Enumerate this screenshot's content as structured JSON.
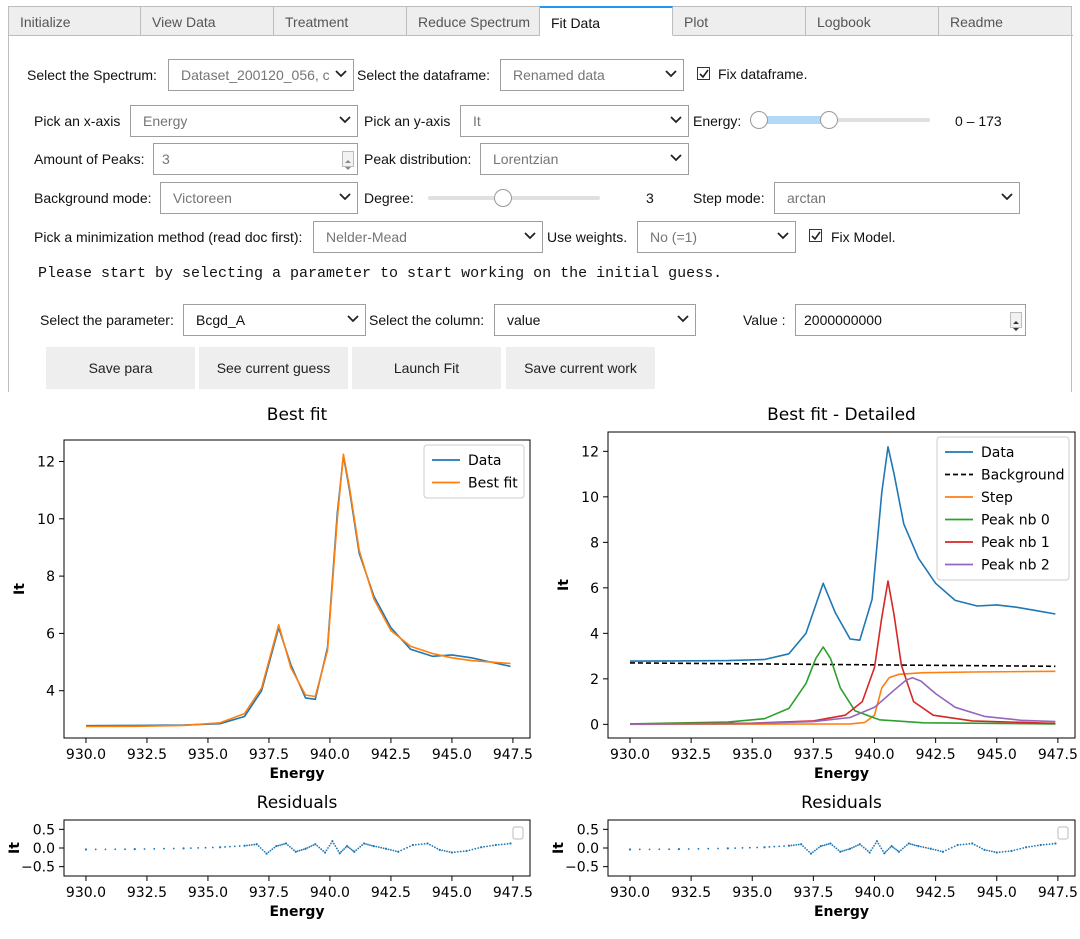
{
  "tabs": [
    "Initialize",
    "View Data",
    "Treatment",
    "Reduce Spectrum",
    "Fit Data",
    "Plot",
    "Logbook",
    "Readme"
  ],
  "active_tab": "Fit Data",
  "form": {
    "spectrum_label": "Select the Spectrum:",
    "spectrum_value": "Dataset_200120_056, c",
    "dataframe_label": "Select the dataframe:",
    "dataframe_value": "Renamed data",
    "fix_dataframe_label": "Fix dataframe.",
    "fix_dataframe_checked": true,
    "xaxis_label": "Pick an x-axis",
    "xaxis_value": "Energy",
    "yaxis_label": "Pick an y-axis",
    "yaxis_value": "It",
    "energy_label": "Energy:",
    "energy_range_text": "0 – 173",
    "peaks_label": "Amount of Peaks:",
    "peaks_value": "3",
    "peak_dist_label": "Peak distribution:",
    "peak_dist_value": "Lorentzian",
    "bg_mode_label": "Background mode:",
    "bg_mode_value": "Victoreen",
    "degree_label": "Degree:",
    "degree_value": "3",
    "step_mode_label": "Step mode:",
    "step_mode_value": "arctan",
    "minim_label": "Pick a minimization method (read doc first):",
    "minim_value": "Nelder-Mead",
    "weights_label": "Use weights.",
    "weights_value": "No (=1)",
    "fix_model_label": "Fix Model.",
    "fix_model_checked": true,
    "message": "Please start by selecting a parameter to start working on the initial guess.",
    "param_label": "Select the parameter:",
    "param_value": "Bcgd_A",
    "column_label": "Select the column:",
    "column_value": "value",
    "value_label": "Value :",
    "value_value": "2000000000"
  },
  "buttons": [
    "Save para",
    "See current guess",
    "Launch Fit",
    "Save current work"
  ],
  "colors": {
    "tab_accent": "#2196f3",
    "data": "#1f77b4",
    "fit": "#ff7f0e",
    "background": "#000000",
    "step": "#ff7f0e",
    "peak0": "#2ca02c",
    "peak1": "#d62728",
    "peak2": "#9467bd"
  },
  "chart_data": [
    {
      "type": "line",
      "title": "Best fit",
      "xlabel": "Energy",
      "ylabel": "It",
      "xlim": [
        929.1,
        948.2
      ],
      "ylim": [
        2.35,
        12.75
      ],
      "xticks": [
        "930.0",
        "932.5",
        "935.0",
        "937.5",
        "940.0",
        "942.5",
        "945.0",
        "947.5"
      ],
      "yticks": [
        "4",
        "6",
        "8",
        "10",
        "12"
      ],
      "legend": "top-right",
      "series": [
        {
          "name": "Data",
          "x": [
            930.0,
            932.0,
            934.0,
            935.5,
            936.5,
            937.2,
            937.9,
            938.4,
            939.0,
            939.4,
            939.9,
            940.3,
            940.55,
            940.8,
            941.2,
            941.8,
            942.5,
            943.3,
            944.2,
            945.0,
            945.8,
            946.6,
            947.4
          ],
          "y": [
            2.78,
            2.79,
            2.8,
            2.85,
            3.1,
            4.0,
            6.2,
            4.9,
            3.75,
            3.7,
            5.5,
            10.2,
            12.2,
            11.0,
            8.8,
            7.3,
            6.2,
            5.45,
            5.2,
            5.25,
            5.15,
            5.0,
            4.85
          ]
        },
        {
          "name": "Best fit",
          "x": [
            930.0,
            932.0,
            934.0,
            935.5,
            936.5,
            937.2,
            937.9,
            938.4,
            939.0,
            939.4,
            939.9,
            940.3,
            940.55,
            940.8,
            941.2,
            941.8,
            942.5,
            943.3,
            944.2,
            945.0,
            945.8,
            946.6,
            947.4
          ],
          "y": [
            2.75,
            2.76,
            2.79,
            2.88,
            3.2,
            4.1,
            6.3,
            4.8,
            3.85,
            3.8,
            5.4,
            10.0,
            12.25,
            11.1,
            8.9,
            7.2,
            6.1,
            5.55,
            5.3,
            5.15,
            5.05,
            5.0,
            4.95
          ]
        }
      ]
    },
    {
      "type": "line",
      "title": "Best fit - Detailed",
      "xlabel": "Energy",
      "ylabel": "It",
      "xlim": [
        929.1,
        948.2
      ],
      "ylim": [
        -0.6,
        12.85
      ],
      "xticks": [
        "930.0",
        "932.5",
        "935.0",
        "937.5",
        "940.0",
        "942.5",
        "945.0",
        "947.5"
      ],
      "yticks": [
        "0",
        "2",
        "4",
        "6",
        "8",
        "10",
        "12"
      ],
      "legend": "top-right",
      "series": [
        {
          "name": "Data",
          "x": [
            930.0,
            932.0,
            934.0,
            935.5,
            936.5,
            937.2,
            937.9,
            938.4,
            939.0,
            939.4,
            939.9,
            940.3,
            940.55,
            940.8,
            941.2,
            941.8,
            942.5,
            943.3,
            944.2,
            945.0,
            945.8,
            946.6,
            947.4
          ],
          "y": [
            2.78,
            2.79,
            2.8,
            2.85,
            3.1,
            4.0,
            6.2,
            4.9,
            3.75,
            3.7,
            5.5,
            10.2,
            12.2,
            11.0,
            8.8,
            7.3,
            6.2,
            5.45,
            5.2,
            5.25,
            5.15,
            5.0,
            4.85
          ]
        },
        {
          "name": "Background",
          "x": [
            930.0,
            947.4
          ],
          "y": [
            2.7,
            2.55
          ]
        },
        {
          "name": "Step",
          "x": [
            930.0,
            939.0,
            939.6,
            940.0,
            940.3,
            940.6,
            941.0,
            942.0,
            944.0,
            947.4
          ],
          "y": [
            0.0,
            0.02,
            0.08,
            0.4,
            1.6,
            2.05,
            2.2,
            2.27,
            2.3,
            2.33
          ]
        },
        {
          "name": "Peak nb 0",
          "x": [
            930.0,
            934.0,
            935.5,
            936.5,
            937.2,
            937.6,
            937.9,
            938.2,
            938.6,
            939.2,
            940.2,
            942.0,
            947.4
          ],
          "y": [
            0.02,
            0.1,
            0.25,
            0.7,
            1.8,
            2.9,
            3.4,
            2.9,
            1.6,
            0.6,
            0.2,
            0.07,
            0.02
          ]
        },
        {
          "name": "Peak nb 1",
          "x": [
            930.0,
            935.0,
            937.5,
            938.8,
            939.5,
            940.0,
            940.3,
            940.55,
            940.8,
            941.1,
            941.6,
            942.4,
            944.0,
            947.4
          ],
          "y": [
            0.02,
            0.05,
            0.15,
            0.4,
            1.0,
            2.5,
            4.7,
            6.3,
            4.8,
            2.6,
            1.0,
            0.4,
            0.15,
            0.04
          ]
        },
        {
          "name": "Peak nb 2",
          "x": [
            930.0,
            935.0,
            937.5,
            939.0,
            940.0,
            940.8,
            941.3,
            941.55,
            941.9,
            942.5,
            943.3,
            944.5,
            946.0,
            947.4
          ],
          "y": [
            0.01,
            0.04,
            0.12,
            0.3,
            0.75,
            1.5,
            1.95,
            2.05,
            1.9,
            1.35,
            0.75,
            0.35,
            0.18,
            0.12
          ]
        }
      ]
    },
    {
      "type": "scatter",
      "title": "Residuals",
      "xlabel": "Energy",
      "ylabel": "It",
      "xlim": [
        929.1,
        948.2
      ],
      "ylim": [
        -0.75,
        0.75
      ],
      "xticks": [
        "930.0",
        "932.5",
        "935.0",
        "937.5",
        "940.0",
        "942.5",
        "945.0",
        "947.5"
      ],
      "yticks": [
        "0.5",
        "0.0",
        "−0.5"
      ],
      "legend": "top-right",
      "series": [
        {
          "x": [
            930.0,
            932.0,
            934.0,
            935.5,
            936.5,
            937.0,
            937.4,
            937.8,
            938.2,
            938.6,
            939.0,
            939.4,
            939.8,
            940.1,
            940.4,
            940.7,
            941.0,
            941.4,
            941.8,
            942.3,
            942.8,
            943.4,
            944.0,
            944.5,
            945.0,
            945.6,
            946.2,
            946.8,
            947.4
          ],
          "y": [
            -0.04,
            -0.03,
            -0.01,
            0.02,
            0.06,
            0.1,
            -0.15,
            0.05,
            0.12,
            -0.1,
            -0.02,
            0.1,
            -0.12,
            0.18,
            -0.14,
            0.05,
            -0.1,
            0.12,
            0.05,
            -0.02,
            -0.1,
            0.08,
            0.12,
            -0.05,
            -0.12,
            -0.08,
            0.02,
            0.08,
            0.12
          ]
        }
      ]
    },
    {
      "type": "scatter",
      "title": "Residuals",
      "xlabel": "Energy",
      "ylabel": "It",
      "xlim": [
        929.1,
        948.2
      ],
      "ylim": [
        -0.75,
        0.75
      ],
      "xticks": [
        "930.0",
        "932.5",
        "935.0",
        "937.5",
        "940.0",
        "942.5",
        "945.0",
        "947.5"
      ],
      "yticks": [
        "0.5",
        "0.0",
        "−0.5"
      ],
      "legend": "top-right",
      "series": [
        {
          "x": [
            930.0,
            932.0,
            934.0,
            935.5,
            936.5,
            937.0,
            937.4,
            937.8,
            938.2,
            938.6,
            939.0,
            939.4,
            939.8,
            940.1,
            940.4,
            940.7,
            941.0,
            941.4,
            941.8,
            942.3,
            942.8,
            943.4,
            944.0,
            944.5,
            945.0,
            945.6,
            946.2,
            946.8,
            947.4
          ],
          "y": [
            -0.04,
            -0.03,
            -0.01,
            0.02,
            0.06,
            0.1,
            -0.15,
            0.05,
            0.12,
            -0.1,
            -0.02,
            0.1,
            -0.12,
            0.18,
            -0.14,
            0.05,
            -0.1,
            0.12,
            0.05,
            -0.02,
            -0.1,
            0.08,
            0.12,
            -0.05,
            -0.12,
            -0.08,
            0.02,
            0.08,
            0.12
          ]
        }
      ]
    }
  ]
}
